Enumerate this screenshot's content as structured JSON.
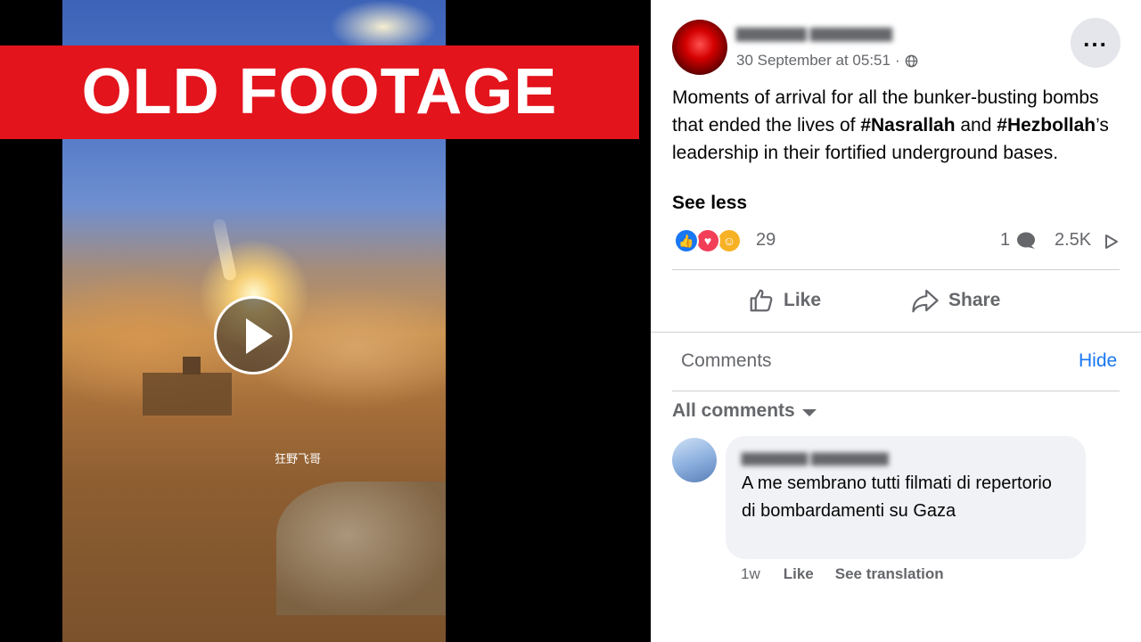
{
  "banner": {
    "label": "OLD FOOTAGE",
    "color": "#e3141c"
  },
  "video": {
    "watermark": "狂野飞哥",
    "play_icon": "play-icon"
  },
  "post": {
    "date": "30 September at 05:51",
    "separator": "·",
    "audience_icon": "globe-icon",
    "more_icon": "more-horizontal-icon",
    "text_before_1": "Moments of arrival for all the bunker-busting bombs that ended the lives of ",
    "hashtag_1": "#Nasrallah",
    "text_middle": " and ",
    "hashtag_2": "#Hezbollah",
    "text_after": "’s leadership in their fortified underground bases.",
    "see_less": "See less"
  },
  "reactions": {
    "icons": [
      "like-reaction-icon",
      "love-reaction-icon",
      "care-reaction-icon"
    ],
    "count": "29",
    "comment_count": "1",
    "share_count": "2.5K"
  },
  "actions": {
    "like_label": "Like",
    "share_label": "Share"
  },
  "comments_header": {
    "label": "Comments",
    "hide_label": "Hide",
    "all_comments_label": "All comments"
  },
  "comment": {
    "text": "A me sembrano tutti filmati di repertorio di bombardamenti su Gaza",
    "time": "1w",
    "like_label": "Like",
    "translation_label": "See translation"
  },
  "colors": {
    "accent": "#1877f2",
    "secondary_text": "#65676b",
    "bubble_bg": "#f0f2f5"
  }
}
